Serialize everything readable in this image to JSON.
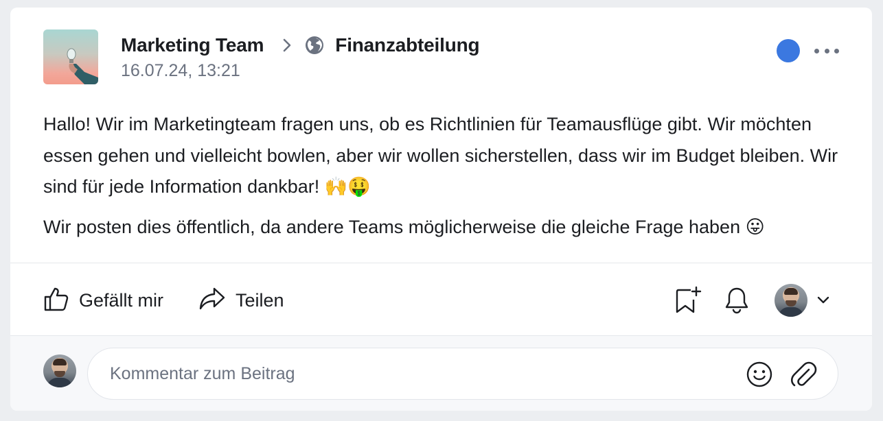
{
  "post": {
    "author": "Marketing Team",
    "destination": "Finanzabteilung",
    "timestamp": "16.07.24, 13:21",
    "status_color": "#3b78e0",
    "paragraphs": [
      "Hallo! Wir im Marketingteam fragen uns, ob es Richtlinien für Teamausflüge gibt. Wir möchten essen gehen und vielleicht bowlen, aber wir wollen sicherstellen, dass wir im Budget bleiben. Wir sind für jede Information dankbar! 🙌🤑",
      "Wir posten dies öffentlich, da andere Teams möglicherweise die gleiche Frage haben 😛"
    ]
  },
  "actions": {
    "like_label": "Gefällt mir",
    "share_label": "Teilen"
  },
  "icons": {
    "group": "lightbulb-photo",
    "breadcrumb_separator": "chevron-right-icon",
    "visibility": "globe-icon",
    "menu": "more-horizontal-icon",
    "like": "thumbs-up-icon",
    "share": "share-arrow-icon",
    "bookmark": "bookmark-plus-icon",
    "notify": "bell-icon",
    "avatar_menu": "chevron-down-icon",
    "emoji": "smiley-icon",
    "attach": "paperclip-icon"
  },
  "comment": {
    "placeholder": "Kommentar zum Beitrag"
  }
}
